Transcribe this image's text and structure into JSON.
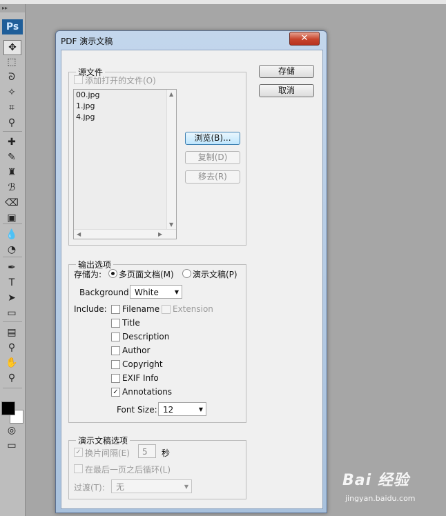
{
  "toolbox": {
    "grip": "▸▸",
    "logo": "Ps",
    "tools": [
      {
        "name": "move-tool-icon",
        "glyph": "✥"
      },
      {
        "name": "marquee-tool-icon",
        "glyph": "⬚"
      },
      {
        "name": "lasso-tool-icon",
        "glyph": "ᘐ"
      },
      {
        "name": "magic-wand-tool-icon",
        "glyph": "✧"
      },
      {
        "name": "crop-tool-icon",
        "glyph": "⌗"
      },
      {
        "name": "eyedropper-tool-icon",
        "glyph": "⚲"
      },
      {
        "name": "healing-brush-tool-icon",
        "glyph": "✚"
      },
      {
        "name": "brush-tool-icon",
        "glyph": "✎"
      },
      {
        "name": "clone-stamp-tool-icon",
        "glyph": "♜"
      },
      {
        "name": "history-brush-tool-icon",
        "glyph": "ℬ"
      },
      {
        "name": "eraser-tool-icon",
        "glyph": "⌫"
      },
      {
        "name": "gradient-tool-icon",
        "glyph": "▣"
      },
      {
        "name": "blur-tool-icon",
        "glyph": "💧"
      },
      {
        "name": "dodge-tool-icon",
        "glyph": "◔"
      },
      {
        "name": "pen-tool-icon",
        "glyph": "✒"
      },
      {
        "name": "type-tool-icon",
        "glyph": "T"
      },
      {
        "name": "path-selection-tool-icon",
        "glyph": "➤"
      },
      {
        "name": "shape-tool-icon",
        "glyph": "▭"
      },
      {
        "name": "notes-tool-icon",
        "glyph": "▤"
      },
      {
        "name": "color-sampler-tool-icon",
        "glyph": "⚲"
      },
      {
        "name": "hand-tool-icon",
        "glyph": "✋"
      },
      {
        "name": "zoom-tool-icon",
        "glyph": "⚲"
      },
      {
        "name": "quick-mask-icon",
        "glyph": "◎"
      },
      {
        "name": "screen-mode-icon",
        "glyph": "▭"
      }
    ],
    "colors": {
      "foreground": "#000000",
      "background": "#ffffff"
    }
  },
  "dialog": {
    "title": "PDF 演示文稿",
    "close_glyph": "✕",
    "save_label": "存储",
    "cancel_label": "取消",
    "source": {
      "legend": "源文件",
      "add_open_files": "添加打开的文件(O)",
      "add_open_files_checked": false,
      "files": [
        "00.jpg",
        "1.jpg",
        "4.jpg"
      ],
      "browse_label": "浏览(B)...",
      "duplicate_label": "复制(D)",
      "remove_label": "移去(R)"
    },
    "output": {
      "legend": "输出选项",
      "save_as_label": "存储为:",
      "option_multipage": "多页面文档(M)",
      "option_presentation": "演示文稿(P)",
      "selected": "multipage",
      "background_label": "Background:",
      "background_value": "White",
      "include_label": "Include:",
      "includes": [
        {
          "label": "Filename",
          "checked": false
        },
        {
          "label": "Title",
          "checked": false
        },
        {
          "label": "Description",
          "checked": false
        },
        {
          "label": "Author",
          "checked": false
        },
        {
          "label": "Copyright",
          "checked": false
        },
        {
          "label": "EXIF Info",
          "checked": false
        },
        {
          "label": "Annotations",
          "checked": true
        }
      ],
      "extension_label": "Extension",
      "extension_checked": false,
      "font_size_label": "Font Size:",
      "font_size_value": "12"
    },
    "presentation": {
      "legend": "演示文稿选项",
      "advance_label": "换片间隔(E)",
      "advance_checked": true,
      "advance_value": "5",
      "seconds_label": "秒",
      "loop_label": "在最后一页之后循环(L)",
      "loop_checked": false,
      "transition_label": "过渡(T):",
      "transition_value": "无"
    }
  },
  "watermark": {
    "brand": "Bai 经验",
    "url": "jingyan.baidu.com"
  }
}
